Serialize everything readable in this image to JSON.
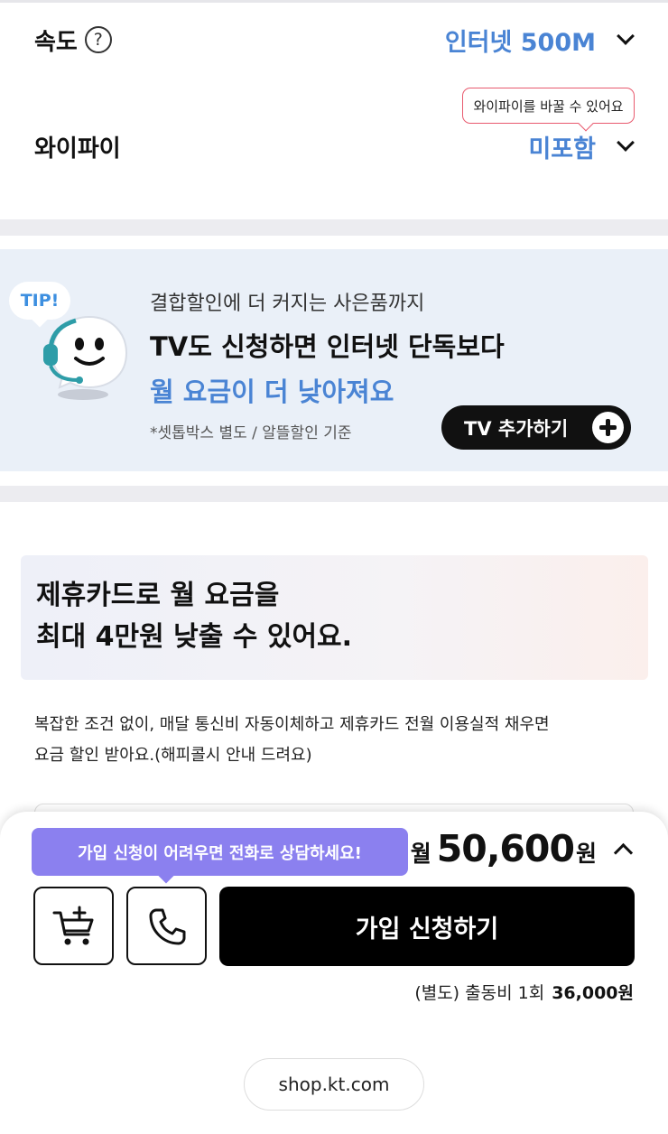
{
  "options": {
    "speed": {
      "label": "속도",
      "help": "?",
      "value": "인터넷 500M"
    },
    "wifi": {
      "label": "와이파이",
      "value": "미포함",
      "tooltip": "와이파이를 바꿀 수 있어요"
    }
  },
  "tip_banner": {
    "badge": "TIP!",
    "subtitle": "결합할인에 더 커지는 사은품까지",
    "title": "TV도 신청하면 인터넷 단독보다",
    "highlight": "월 요금이 더 낮아져요",
    "note": "*셋톱박스 별도 / 알뜰할인 기준",
    "button": "TV 추가하기"
  },
  "card_promo": {
    "line1": "제휴카드로 월 요금을",
    "line2": "최대 4만원 낮출 수 있어요.",
    "desc_line1": "복잡한 조건 없이, 매달 통신비 자동이체하고 제휴카드 전월 이용실적 채우면",
    "desc_line2": "요금 할인 받아요.(해피콜시 안내 드려요)"
  },
  "bottom_sheet": {
    "call_tip": "가입 신청이 어려우면 전화로 상담하세요!",
    "price_prefix": "월",
    "price": "50,600",
    "price_suffix": "원",
    "apply": "가입 신청하기",
    "fee_label": "(별도) 출동비 1회",
    "fee_value": "36,000원"
  },
  "browser": {
    "url": "shop.kt.com"
  },
  "icons": [
    "help-icon",
    "chevron-down-icon",
    "mascot-icon",
    "plus-icon",
    "chevron-up-icon",
    "cart-add-icon",
    "phone-icon"
  ],
  "colors": {
    "accent_blue": "#4a84d4",
    "tooltip_border": "#e85a6e",
    "call_tip_bg": "#8b80ef",
    "primary_button": "#000000"
  }
}
